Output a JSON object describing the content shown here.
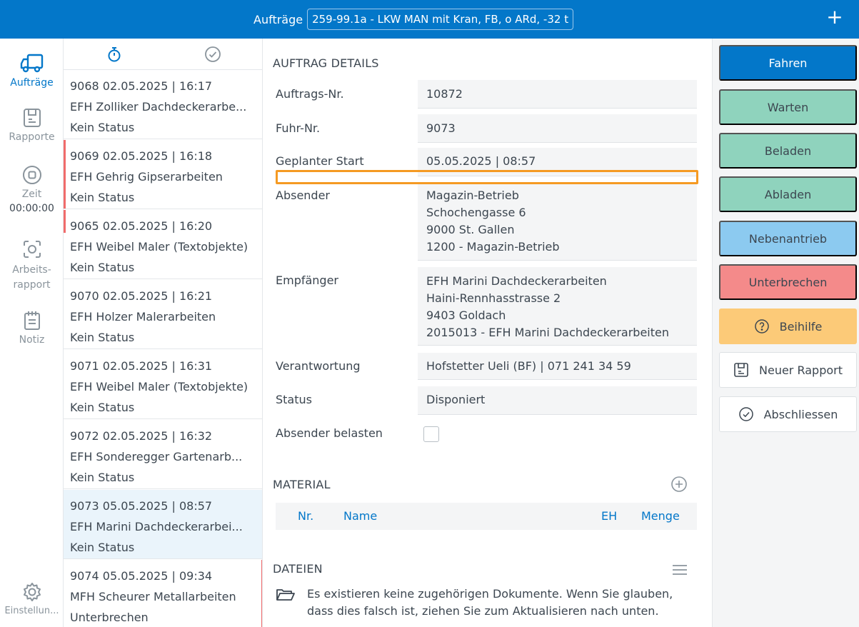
{
  "header": {
    "title_label": "Aufträge",
    "vehicle_select": "259-99.1a - LKW MAN mit Kran, FB, o ARd, -32 t",
    "add_label": "+"
  },
  "nav": {
    "orders": "Aufträge",
    "reports": "Rapporte",
    "time": "Zeit",
    "time_value": "00:00:00",
    "work_report": "Arbeits-\nrapport",
    "work_report_line1": "Arbeits-",
    "work_report_line2": "rapport",
    "note": "Notiz",
    "settings": "Einstellun..."
  },
  "orders": [
    {
      "line1": "9068  02.05.2025 | 16:17",
      "line2": "EFH Zolliker Dachdeckerarbe...",
      "line3": "Kein Status"
    },
    {
      "line1": "9069  02.05.2025 | 16:18",
      "line2": "EFH Gehrig Gipserarbeiten",
      "line3": "Kein Status"
    },
    {
      "line1": "9065  02.05.2025 | 16:20",
      "line2": "EFH Weibel Maler (Textobjekte)",
      "line3": "Kein Status"
    },
    {
      "line1": "9070  02.05.2025 | 16:21",
      "line2": "EFH Holzer Malerarbeiten",
      "line3": "Kein Status"
    },
    {
      "line1": "9071  02.05.2025 | 16:31",
      "line2": "EFH Weibel Maler (Textobjekte)",
      "line3": "Kein Status"
    },
    {
      "line1": "9072  02.05.2025 | 16:32",
      "line2": "EFH Sonderegger Gartenarb...",
      "line3": "Kein Status"
    },
    {
      "line1": "9073  05.05.2025 | 08:57",
      "line2": "EFH Marini Dachdeckerarbei...",
      "line3": "Kein Status"
    },
    {
      "line1": "9074  05.05.2025 | 09:34",
      "line2": "MFH Scheurer Metallarbeiten",
      "line3": "Unterbrechen"
    }
  ],
  "details": {
    "section_title": "AUFTRAG DETAILS",
    "order_no_label": "Auftrags-Nr.",
    "order_no": "10872",
    "trip_no_label": "Fuhr-Nr.",
    "trip_no": "9073",
    "planned_start_label": "Geplanter Start",
    "planned_start": "05.05.2025 | 08:57",
    "sender_label": "Absender",
    "sender_lines": [
      "Magazin-Betrieb",
      "Schochengasse 6",
      "9000 St. Gallen",
      "1200 - Magazin-Betrieb"
    ],
    "recipient_label": "Empfänger",
    "recipient_lines": [
      "EFH Marini Dachdeckerarbeiten",
      "Haini-Rennhasstrasse 2",
      "9403 Goldach",
      "2015013 - EFH Marini Dachdeckerarbeiten"
    ],
    "responsible_label": "Verantwortung",
    "responsible": "Hofstetter Ueli (BF) | 071 241 34 59",
    "status_label": "Status",
    "status": "Disponiert",
    "charge_sender_label": "Absender belasten"
  },
  "material": {
    "title": "MATERIAL",
    "col_nr": "Nr.",
    "col_name": "Name",
    "col_unit": "EH",
    "col_qty": "Menge"
  },
  "files": {
    "title": "DATEIEN",
    "empty_line1": "Es existieren keine zugehörigen Dokumente. Wenn Sie glauben,",
    "empty_line2": "dass dies falsch ist, ziehen Sie zum Aktualisieren nach unten."
  },
  "actions": {
    "drive": "Fahren",
    "wait": "Warten",
    "load": "Beladen",
    "unload": "Abladen",
    "pto": "Nebenantrieb",
    "interrupt": "Unterbrechen",
    "help": "Beihilfe",
    "new_report": "Neuer Rapport",
    "complete": "Abschliessen"
  },
  "colors": {
    "primary": "#0377c9",
    "green": "#8fd3bd",
    "light_blue": "#8ccaf0",
    "red": "#f48a8a",
    "orange": "#fcca78",
    "highlight": "#f59a23"
  }
}
